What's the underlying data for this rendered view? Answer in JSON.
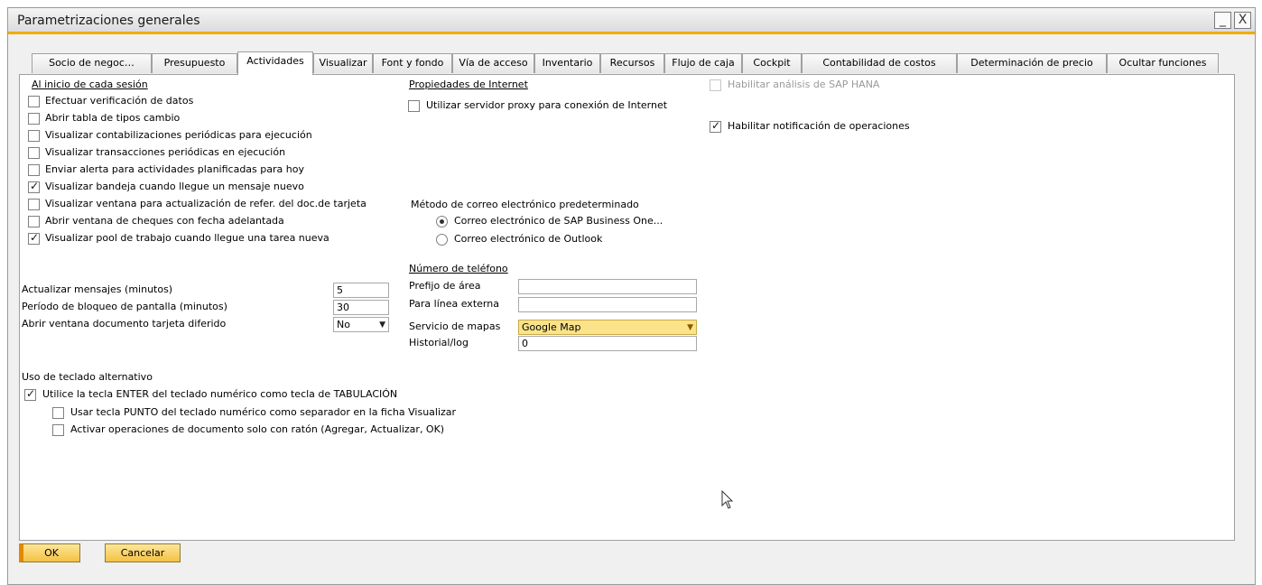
{
  "window": {
    "title": "Parametrizaciones generales",
    "minimize": "_",
    "close": "X"
  },
  "tabs": [
    "Socio de negoc…",
    "Presupuesto",
    "Actividades",
    "Visualizar",
    "Font y fondo",
    "Vía de acceso",
    "Inventario",
    "Recursos",
    "Flujo de caja",
    "Cockpit",
    "Contabilidad de costos",
    "Determinación de precio",
    "Ocultar funciones"
  ],
  "session": {
    "header": "Al inicio de cada sesión",
    "items": [
      {
        "label": "Efectuar verificación de datos",
        "checked": false
      },
      {
        "label": "Abrir tabla de tipos cambio",
        "checked": false
      },
      {
        "label": "Visualizar contabilizaciones periódicas para ejecución",
        "checked": false
      },
      {
        "label": "Visualizar transacciones periódicas en ejecución",
        "checked": false
      },
      {
        "label": "Enviar alerta para actividades planificadas para hoy",
        "checked": false
      },
      {
        "label": "Visualizar bandeja cuando llegue un mensaje nuevo",
        "checked": true
      },
      {
        "label": "Visualizar ventana para actualización de refer. del doc.de tarjeta",
        "checked": false
      },
      {
        "label": "Abrir ventana de cheques con fecha adelantada",
        "checked": false
      },
      {
        "label": "Visualizar pool de trabajo cuando llegue una tarea nueva",
        "checked": true
      }
    ]
  },
  "settings": {
    "rows": [
      {
        "label": "Actualizar mensajes (minutos)",
        "value": "5"
      },
      {
        "label": "Período de bloqueo de pantalla (minutos)",
        "value": "30"
      },
      {
        "label": "Abrir ventana documento tarjeta diferido",
        "value": "No"
      }
    ]
  },
  "internet": {
    "header": "Propiedades de Internet",
    "proxy_label": "Utilizar servidor proxy para conexión de Internet",
    "proxy_checked": false
  },
  "email": {
    "label": "Método de correo electrónico predeterminado",
    "options": [
      {
        "label": "Correo electrónico de SAP Business One...",
        "selected": true
      },
      {
        "label": "Correo electrónico de Outlook",
        "selected": false
      }
    ]
  },
  "phone": {
    "header": "Número de teléfono",
    "rows": [
      {
        "label": "Prefijo de área",
        "value": ""
      },
      {
        "label": "Para línea externa",
        "value": ""
      },
      {
        "label": "Servicio de mapas",
        "value": "Google Map"
      },
      {
        "label": "Historial/log",
        "value": "0"
      }
    ]
  },
  "right": {
    "hana_label": "Habilitar análisis de SAP HANA",
    "hana_checked": false,
    "notif_label": "Habilitar notificación de operaciones",
    "notif_checked": true
  },
  "keyboard": {
    "header": "Uso de teclado alternativo",
    "enter_label": "Utilice la tecla ENTER del teclado numérico como tecla de TABULACIÓN",
    "enter_checked": true,
    "punto_label": "Usar tecla PUNTO del teclado numérico como separador en la ficha Visualizar",
    "punto_checked": false,
    "mouse_label": "Activar operaciones de documento solo con ratón (Agregar, Actualizar, OK)",
    "mouse_checked": false
  },
  "buttons": {
    "ok": "OK",
    "cancel": "Cancelar"
  },
  "colors": {
    "accent": "#f0ab00",
    "map_field": "#fbe38a"
  },
  "icons": {
    "dropdown": "chevron-down-icon",
    "cursor": "mouse-pointer-icon"
  }
}
